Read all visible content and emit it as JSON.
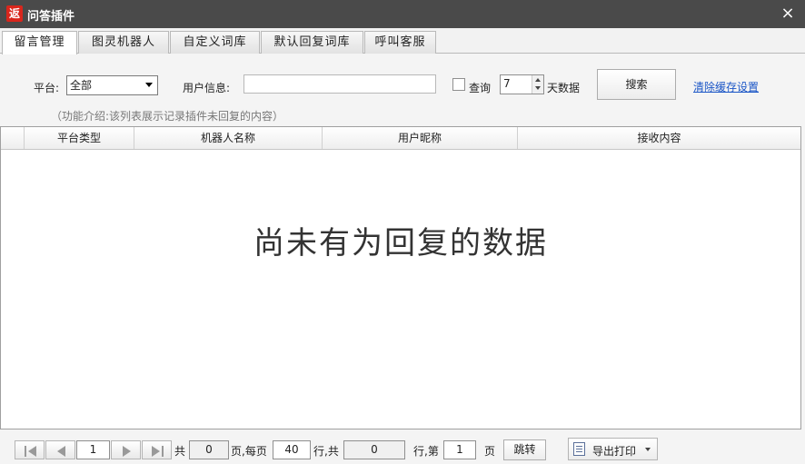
{
  "window": {
    "app_icon_text": "返",
    "title": "问答插件",
    "close_glyph": "×"
  },
  "tabs": [
    {
      "label": "留言管理",
      "active": true
    },
    {
      "label": "图灵机器人",
      "active": false
    },
    {
      "label": "自定义词库",
      "active": false
    },
    {
      "label": "默认回复词库",
      "active": false
    },
    {
      "label": "呼叫客服",
      "active": false
    }
  ],
  "filters": {
    "platform_label": "平台:",
    "platform_value": "全部",
    "user_info_label": "用户信息:",
    "user_info_value": "",
    "query_checkbox_label": "查询",
    "query_checked": false,
    "days_value": "7",
    "days_suffix": "天数据",
    "search_button": "搜索",
    "clear_cache_link": "清除缓存设置"
  },
  "intro_text": "（功能介绍:该列表展示记录插件未回复的内容）",
  "table": {
    "columns": [
      "平台类型",
      "机器人名称",
      "用户昵称",
      "接收内容"
    ],
    "rows": [],
    "empty_message": "尚未有为回复的数据"
  },
  "pagination": {
    "current_page": "1",
    "total_label": "共",
    "total_pages": "0",
    "per_page_label": "页,每页",
    "per_page": "40",
    "rows_total_label": "行,共",
    "total_rows": "0",
    "goto_label": "行,第",
    "goto_page": "1",
    "page_suffix": "页",
    "jump_button": "跳转",
    "export_button": "导出打印"
  },
  "colors": {
    "titlebar": "#4a4a4a",
    "app_icon": "#d9261c",
    "link": "#1a55c6"
  }
}
